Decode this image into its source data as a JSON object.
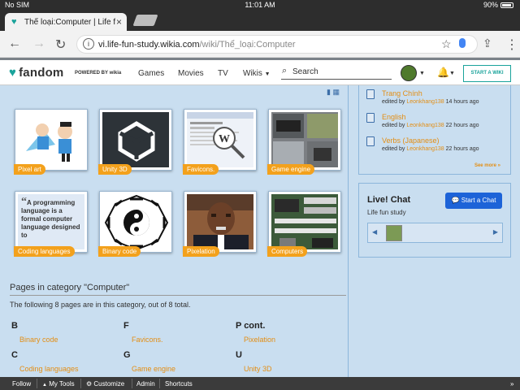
{
  "status": {
    "carrier": "No SIM",
    "time": "11:01 AM",
    "battery": "90%"
  },
  "browser": {
    "tab_title": "Thể loại:Computer | Life fun",
    "url_host": "vi.life-fun-study.wikia.com",
    "url_path": "/wiki/Thể_loại:Computer"
  },
  "fandom": {
    "logo": "fandom",
    "powered_by": "POWERED BY wikia",
    "nav": [
      "Games",
      "Movies",
      "TV",
      "Wikis"
    ],
    "search_placeholder": "Search",
    "start_wiki": "START A WIKI"
  },
  "gallery": {
    "items": [
      {
        "label": "Pixel art"
      },
      {
        "label": "Unity 3D"
      },
      {
        "label": "Favicons."
      },
      {
        "label": "Game engine"
      },
      {
        "label": "Coding languages",
        "quote": "A programming language is a formal computer language designed to"
      },
      {
        "label": "Binary code"
      },
      {
        "label": "Pixelation"
      },
      {
        "label": "Computers"
      }
    ]
  },
  "category": {
    "title": "Pages in category \"Computer\"",
    "description": "The following 8 pages are in this category, out of 8 total.",
    "groups": [
      {
        "letter": "B",
        "link": "Binary code"
      },
      {
        "letter": "F",
        "link": "Favicons."
      },
      {
        "letter": "P cont.",
        "link": "Pixelation"
      },
      {
        "letter": "C",
        "link": "Coding languages"
      },
      {
        "letter": "G",
        "link": "Game engine"
      },
      {
        "letter": "U",
        "link": "Unity 3D"
      }
    ]
  },
  "recent": {
    "items": [
      {
        "title": "Trang Chính",
        "by": "edited by",
        "user": "Leonkhang138",
        "when": "14 hours ago"
      },
      {
        "title": "English",
        "by": "edited by",
        "user": "Leonkhang138",
        "when": "22 hours ago"
      },
      {
        "title": "Verbs (Japanese)",
        "by": "edited by",
        "user": "Leonkhang138",
        "when": "22 hours ago"
      }
    ],
    "see_more": "See more »"
  },
  "chat": {
    "title": "Live! Chat",
    "subtitle": "Life fun study",
    "button": "Start a Chat"
  },
  "bottom_bar": {
    "follow": "Follow",
    "my_tools": "My Tools",
    "customize": "Customize",
    "admin": "Admin",
    "shortcuts": "Shortcuts"
  }
}
